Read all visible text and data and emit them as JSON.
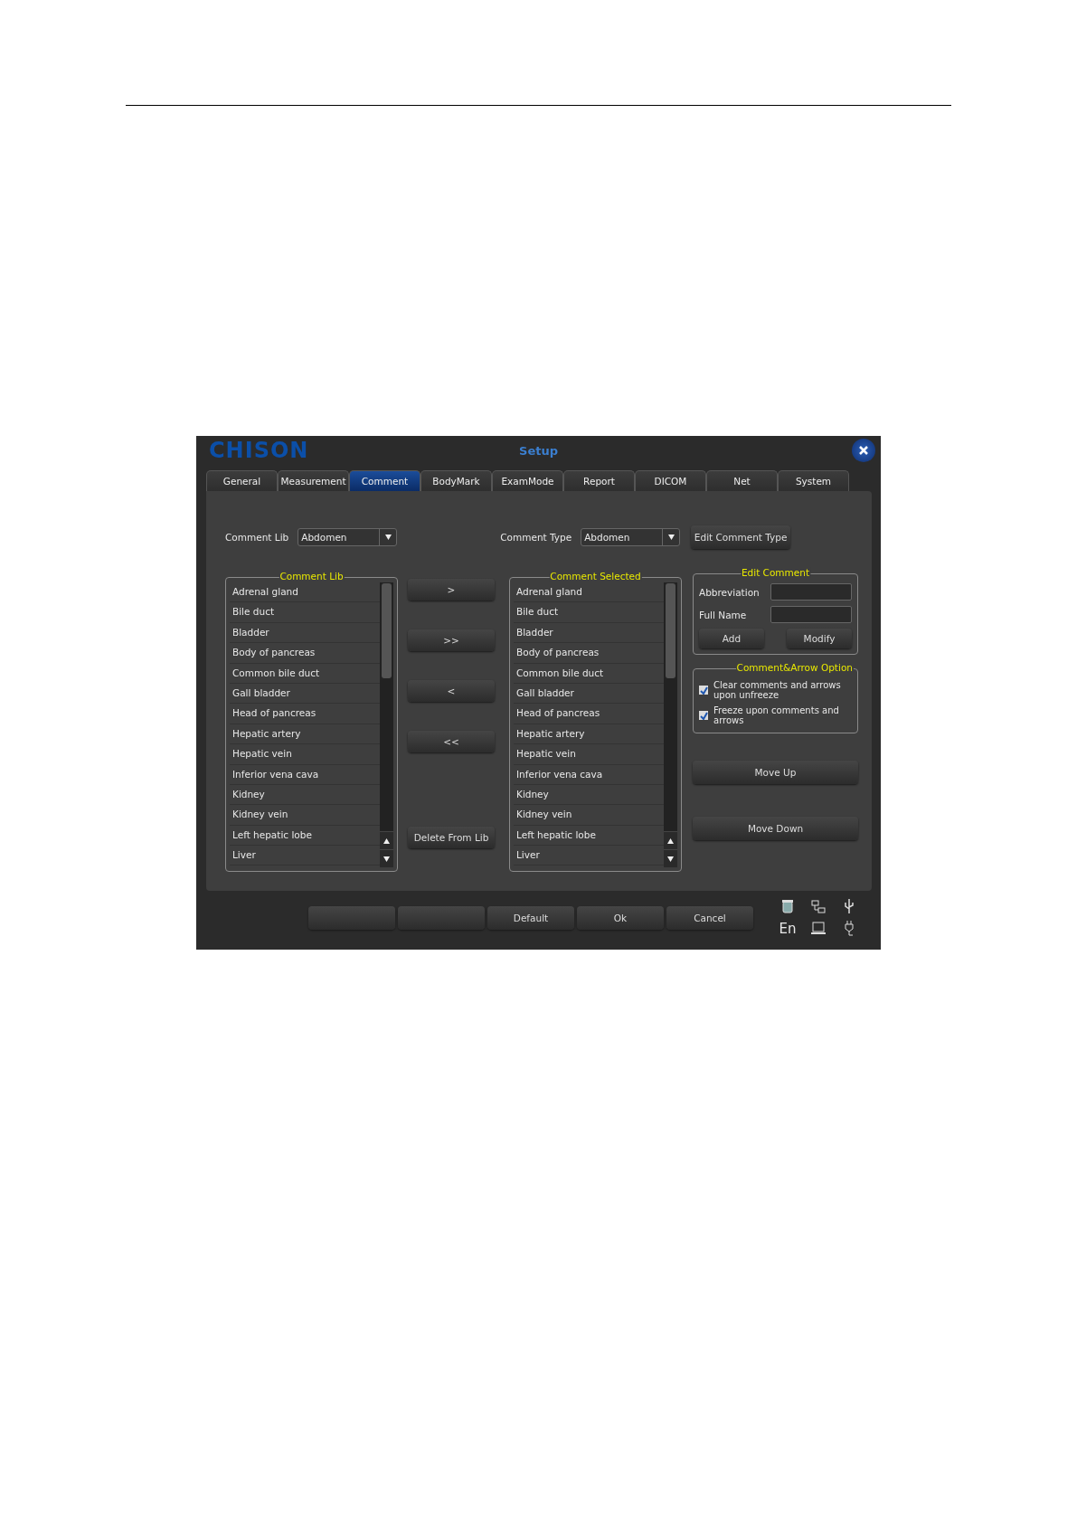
{
  "window": {
    "logo": "CHISON",
    "title": "Setup"
  },
  "tabs": [
    {
      "label": "General",
      "selected": false
    },
    {
      "label": "Measurement",
      "selected": false
    },
    {
      "label": "Comment",
      "selected": true
    },
    {
      "label": "BodyMark",
      "selected": false
    },
    {
      "label": "ExamMode",
      "selected": false
    },
    {
      "label": "Report",
      "selected": false
    },
    {
      "label": "DICOM",
      "selected": false
    },
    {
      "label": "Net",
      "selected": false
    },
    {
      "label": "System",
      "selected": false
    }
  ],
  "comment_lib_select": {
    "label": "Comment Lib",
    "value": "Abdomen"
  },
  "comment_type_select": {
    "label": "Comment Type",
    "value": "Abdomen"
  },
  "edit_comment_type_button": "Edit Comment Type",
  "lists": [
    {
      "title": "Comment Lib",
      "items": [
        "Adrenal gland",
        "Bile duct",
        "Bladder",
        "Body of pancreas",
        "Common bile duct",
        "Gall bladder",
        "Head of pancreas",
        "Hepatic artery",
        "Hepatic vein",
        "Inferior vena cava",
        "Kidney",
        "Kidney vein",
        "Left hepatic lobe",
        "Liver"
      ]
    },
    {
      "title": "Comment Selected",
      "items": [
        "Adrenal gland",
        "Bile duct",
        "Bladder",
        "Body of pancreas",
        "Common bile duct",
        "Gall bladder",
        "Head of pancreas",
        "Hepatic artery",
        "Hepatic vein",
        "Inferior vena cava",
        "Kidney",
        "Kidney vein",
        "Left hepatic lobe",
        "Liver"
      ]
    }
  ],
  "transfer_buttons": [
    {
      "kind": "move",
      "label": ">"
    },
    {
      "kind": "move",
      "label": ">>"
    },
    {
      "kind": "move",
      "label": "<"
    },
    {
      "kind": "move",
      "label": "<<"
    },
    {
      "kind": "gap"
    },
    {
      "kind": "move",
      "label": "Delete From Lib"
    }
  ],
  "edit_comment": {
    "title": "Edit Comment",
    "fields": [
      {
        "label": "Abbreviation"
      },
      {
        "label": "Full Name"
      }
    ],
    "buttons": [
      "Add",
      "Modify"
    ]
  },
  "options": {
    "title": "Comment&Arrow Option",
    "items": [
      {
        "label": "Clear comments and arrows upon unfreeze",
        "checked": true
      },
      {
        "label": "Freeze upon comments and arrows",
        "checked": true
      }
    ]
  },
  "order_buttons": [
    "Move Up",
    "Move Down"
  ],
  "bottom_buttons": [
    {
      "kind": "blank"
    },
    {
      "kind": "blank"
    },
    {
      "kind": "action",
      "label": "Default"
    },
    {
      "kind": "action",
      "label": "Ok"
    },
    {
      "kind": "action",
      "label": "Cancel"
    }
  ],
  "status": {
    "language": "En"
  }
}
